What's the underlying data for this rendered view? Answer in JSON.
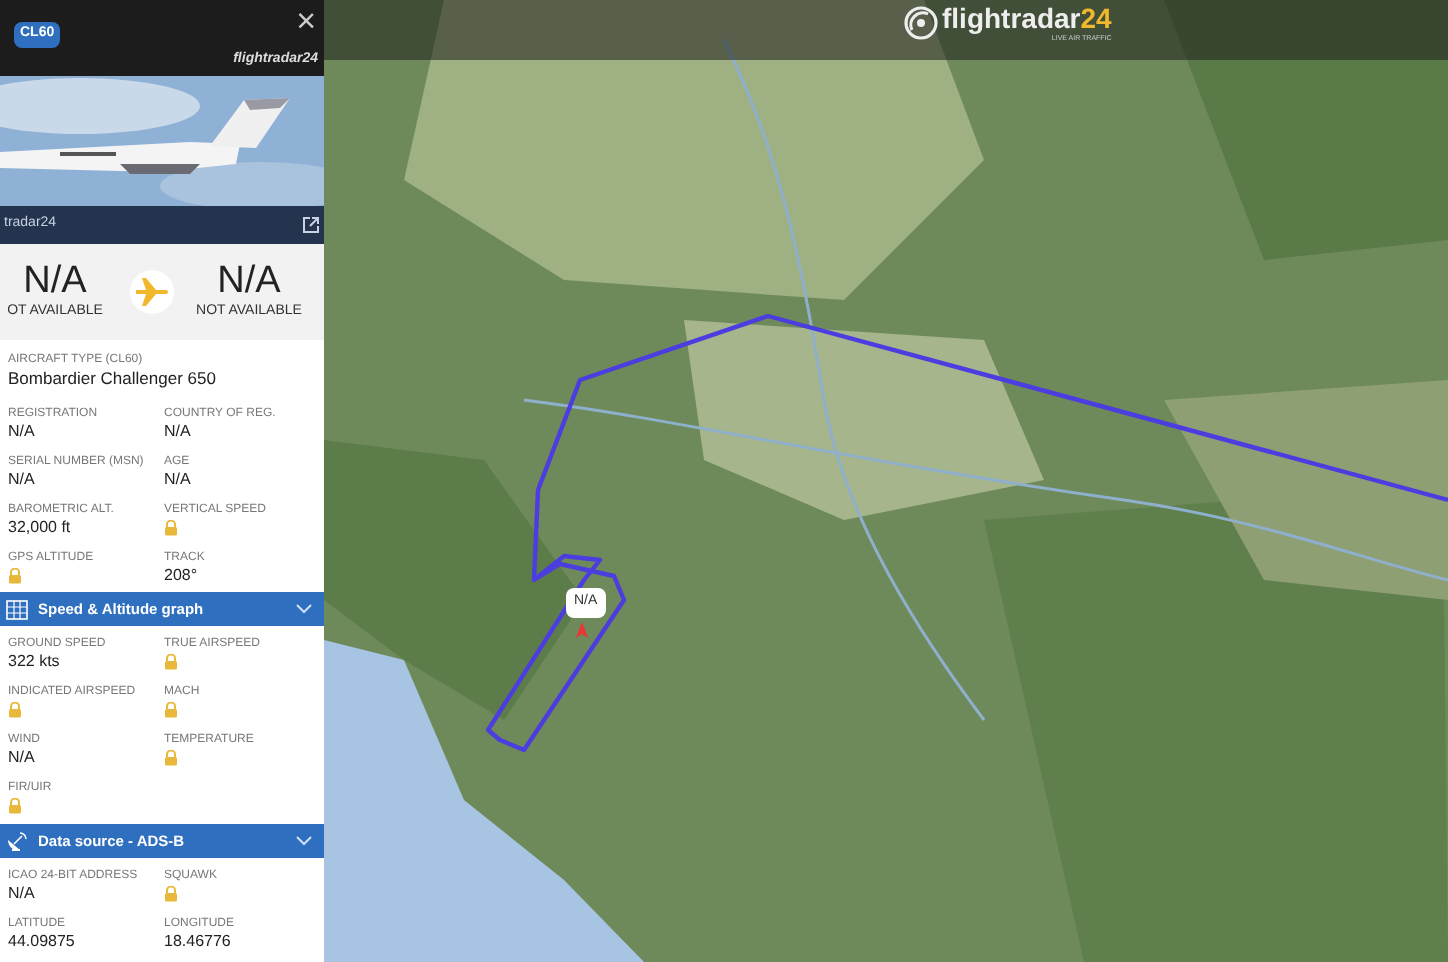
{
  "header": {
    "badge": "CL60",
    "close": "×",
    "brand": "flightradar24"
  },
  "photo": {
    "kind": "picture",
    "credit": "tradar24"
  },
  "route": {
    "origin": {
      "code": "N/A",
      "name": "OT AVAILABLE"
    },
    "destination": {
      "code": "N/A",
      "name": "NOT AVAILABLE"
    }
  },
  "aircraft_type": {
    "label": "AIRCRAFT TYPE (CL60)",
    "value": "Bombardier Challenger 650"
  },
  "fields": [
    {
      "label": "REGISTRATION",
      "value": "N/A"
    },
    {
      "label": "COUNTRY OF REG.",
      "value": "N/A"
    },
    {
      "label": "SERIAL NUMBER (MSN)",
      "value": "N/A"
    },
    {
      "label": "AGE",
      "value": "N/A"
    },
    {
      "label": "BAROMETRIC ALT.",
      "value": "32,000 ft"
    },
    {
      "label": "VERTICAL SPEED",
      "locked": true
    },
    {
      "label": "GPS ALTITUDE",
      "locked": true
    },
    {
      "label": "TRACK",
      "value": "208°"
    }
  ],
  "sections": [
    {
      "title": "Speed & Altitude graph",
      "expanded": false,
      "fields": [
        {
          "label": "GROUND SPEED",
          "value": "322 kts"
        },
        {
          "label": "TRUE AIRSPEED",
          "locked": true
        },
        {
          "label": "INDICATED AIRSPEED",
          "locked": true
        },
        {
          "label": "MACH",
          "locked": true
        },
        {
          "label": "WIND",
          "value": "N/A"
        },
        {
          "label": "TEMPERATURE",
          "locked": true
        },
        {
          "label": "FIR/UIR",
          "locked": true
        }
      ]
    },
    {
      "title": "Data source - ADS-B",
      "expanded": false,
      "fields": [
        {
          "label": "ICAO 24-BIT ADDRESS",
          "value": "N/A"
        },
        {
          "label": "SQUAWK",
          "locked": true
        },
        {
          "label": "LATITUDE",
          "value": "44.09875"
        },
        {
          "label": "LONGITUDE",
          "value": "18.46776"
        }
      ]
    }
  ],
  "map": {
    "kind": "picture",
    "logo": {
      "name": "flightradar",
      "accent": "24",
      "tagline": "LIVE AIR TRAFFIC"
    },
    "callout": "N/A"
  }
}
